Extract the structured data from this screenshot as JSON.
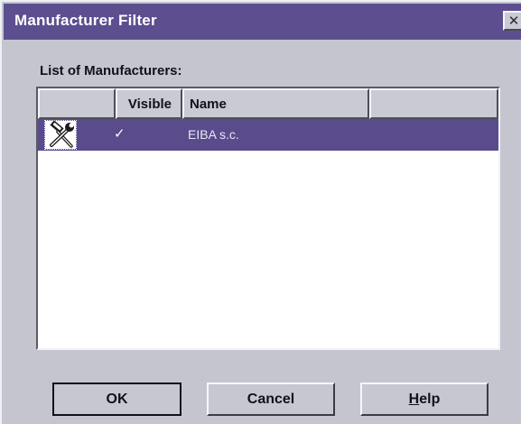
{
  "window": {
    "title": "Manufacturer Filter",
    "close_symbol": "✕"
  },
  "list": {
    "caption": "List of Manufacturers:",
    "columns": [
      "",
      "Visible",
      "Name",
      ""
    ],
    "rows": [
      {
        "icon": "tools-icon",
        "visible": "✓",
        "name": "EIBA s.c.",
        "selected": true
      }
    ]
  },
  "buttons": {
    "ok": "OK",
    "cancel": "Cancel",
    "help_first": "H",
    "help_rest": "elp"
  },
  "colors": {
    "titlebar": "#5d4e8f",
    "selection": "#5a4b8c",
    "face": "#c4c5cf"
  }
}
